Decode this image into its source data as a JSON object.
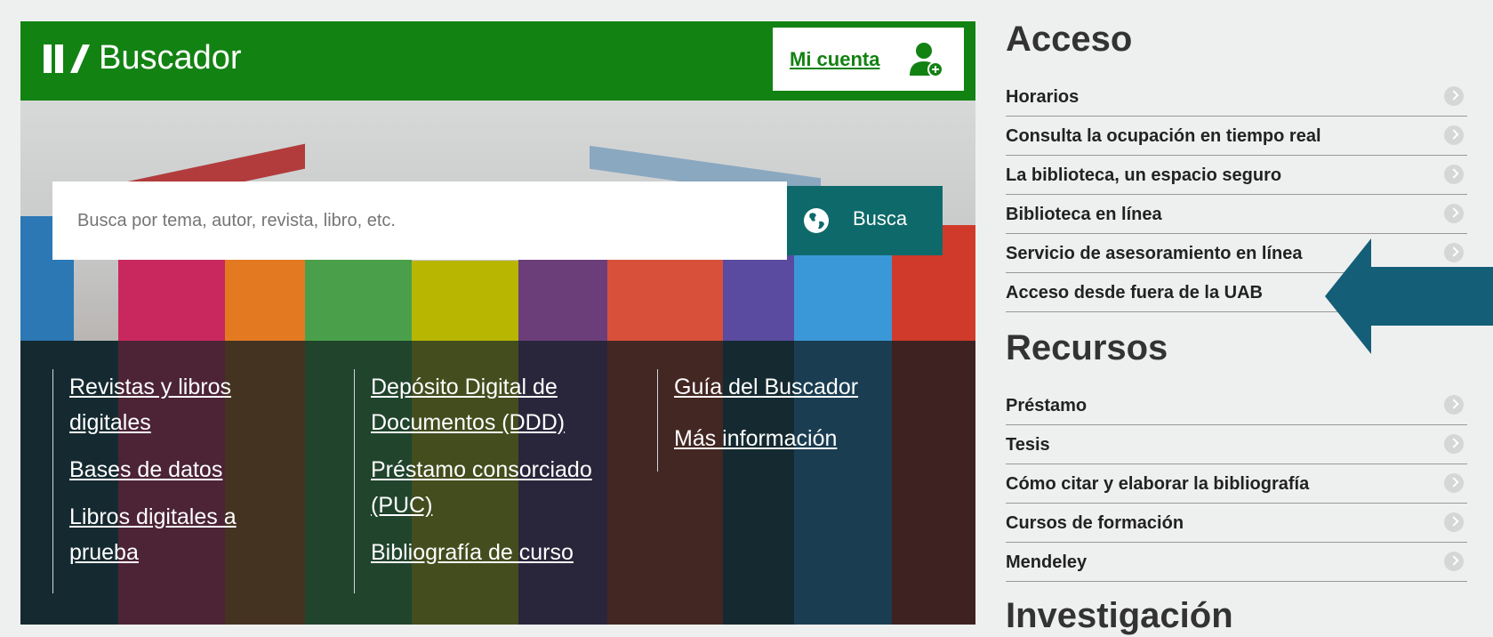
{
  "header": {
    "logo_text": "Buscador",
    "account_label": "Mi cuenta"
  },
  "search": {
    "placeholder": "Busca por tema, autor, revista, libro, etc.",
    "button_label": "Busca"
  },
  "link_columns": [
    [
      "Revistas y libros digitales",
      "Bases de datos",
      "Libros digitales a prueba"
    ],
    [
      "Depósito Digital de Documentos (DDD)",
      "Préstamo consorciado (PUC)",
      "Bibliografía de curso"
    ],
    [
      "Guía del Buscador",
      "Más información"
    ]
  ],
  "sidebar": {
    "acceso": {
      "title": "Acceso",
      "items": [
        "Horarios",
        "Consulta la ocupación en tiempo real",
        "La biblioteca, un espacio seguro",
        "Biblioteca en línea",
        "Servicio de asesoramiento en línea",
        "Acceso desde fuera de la UAB"
      ]
    },
    "recursos": {
      "title": "Recursos",
      "items": [
        "Préstamo",
        "Tesis",
        "Cómo citar y elaborar la bibliografía",
        "Cursos de formación",
        "Mendeley"
      ]
    },
    "investigacion": {
      "title": "Investigación"
    }
  },
  "colors": {
    "brand_green": "#128212",
    "search_button": "#0e6a6a",
    "links_background": "#152a30",
    "arrow": "#155e78"
  },
  "icons": {
    "account": "user-add-icon",
    "search": "globe-icon",
    "item_chevron": "chevron-right-icon",
    "annotation": "left-arrow-icon"
  }
}
